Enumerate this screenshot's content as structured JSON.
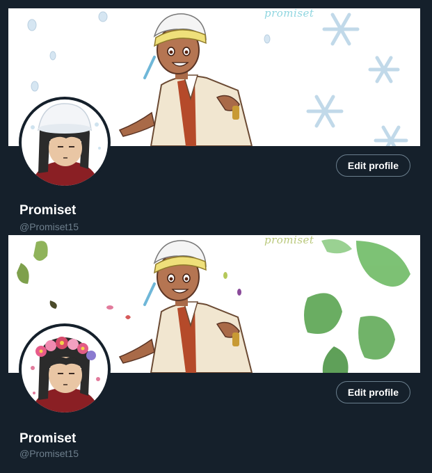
{
  "profiles": [
    {
      "banner_signature": "promiset",
      "banner_theme": "snowflakes",
      "avatar_accessory": "snow-hat",
      "edit_button_label": "Edit profile",
      "display_name": "Promiset",
      "handle": "@Promiset15"
    },
    {
      "banner_signature": "promiset",
      "banner_theme": "leaves",
      "avatar_accessory": "flower-crown",
      "edit_button_label": "Edit profile",
      "display_name": "Promiset",
      "handle": "@Promiset15"
    }
  ],
  "colors": {
    "background": "#15202b",
    "text_primary": "#ffffff",
    "text_secondary": "#6e7f8d",
    "button_border": "#6b7f8e",
    "snow_accent": "#9fc4dc",
    "leaf_accent": "#4f9a48"
  }
}
